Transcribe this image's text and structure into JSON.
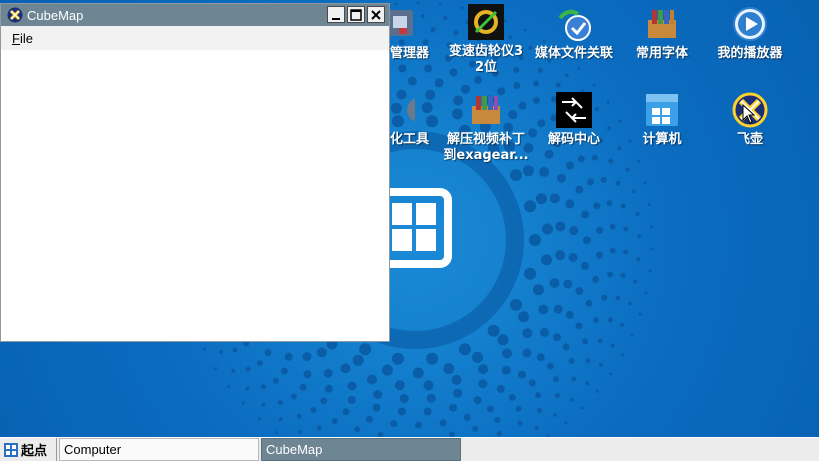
{
  "desktop": {
    "icons": [
      {
        "label": "管理器",
        "icon": "device-manager-icon"
      },
      {
        "label": "变速齿轮仪3\n2位",
        "icon": "speed-gear-icon"
      },
      {
        "label": "媒体文件关联",
        "icon": "media-association-icon"
      },
      {
        "label": "常用字体",
        "icon": "font-archive-icon"
      },
      {
        "label": "我的播放器",
        "icon": "player-icon"
      },
      {
        "label": "化工具",
        "icon": "tools-icon"
      },
      {
        "label": "解压视频补丁\n到exagear...",
        "icon": "archive-icon"
      },
      {
        "label": "解码中心",
        "icon": "decoder-icon"
      },
      {
        "label": "计算机",
        "icon": "computer-icon"
      },
      {
        "label": "飞壶",
        "icon": "feihu-icon"
      }
    ]
  },
  "window": {
    "title": "CubeMap",
    "menu": [
      {
        "mnemonic": "F",
        "rest": "ile"
      }
    ]
  },
  "taskbar": {
    "start_label": "起点",
    "tasks": [
      "Computer",
      "CubeMap"
    ]
  },
  "colors": {
    "titlebar": "#6e8594",
    "desktop": "#0b6cc0",
    "taskbar": "#ececec"
  }
}
